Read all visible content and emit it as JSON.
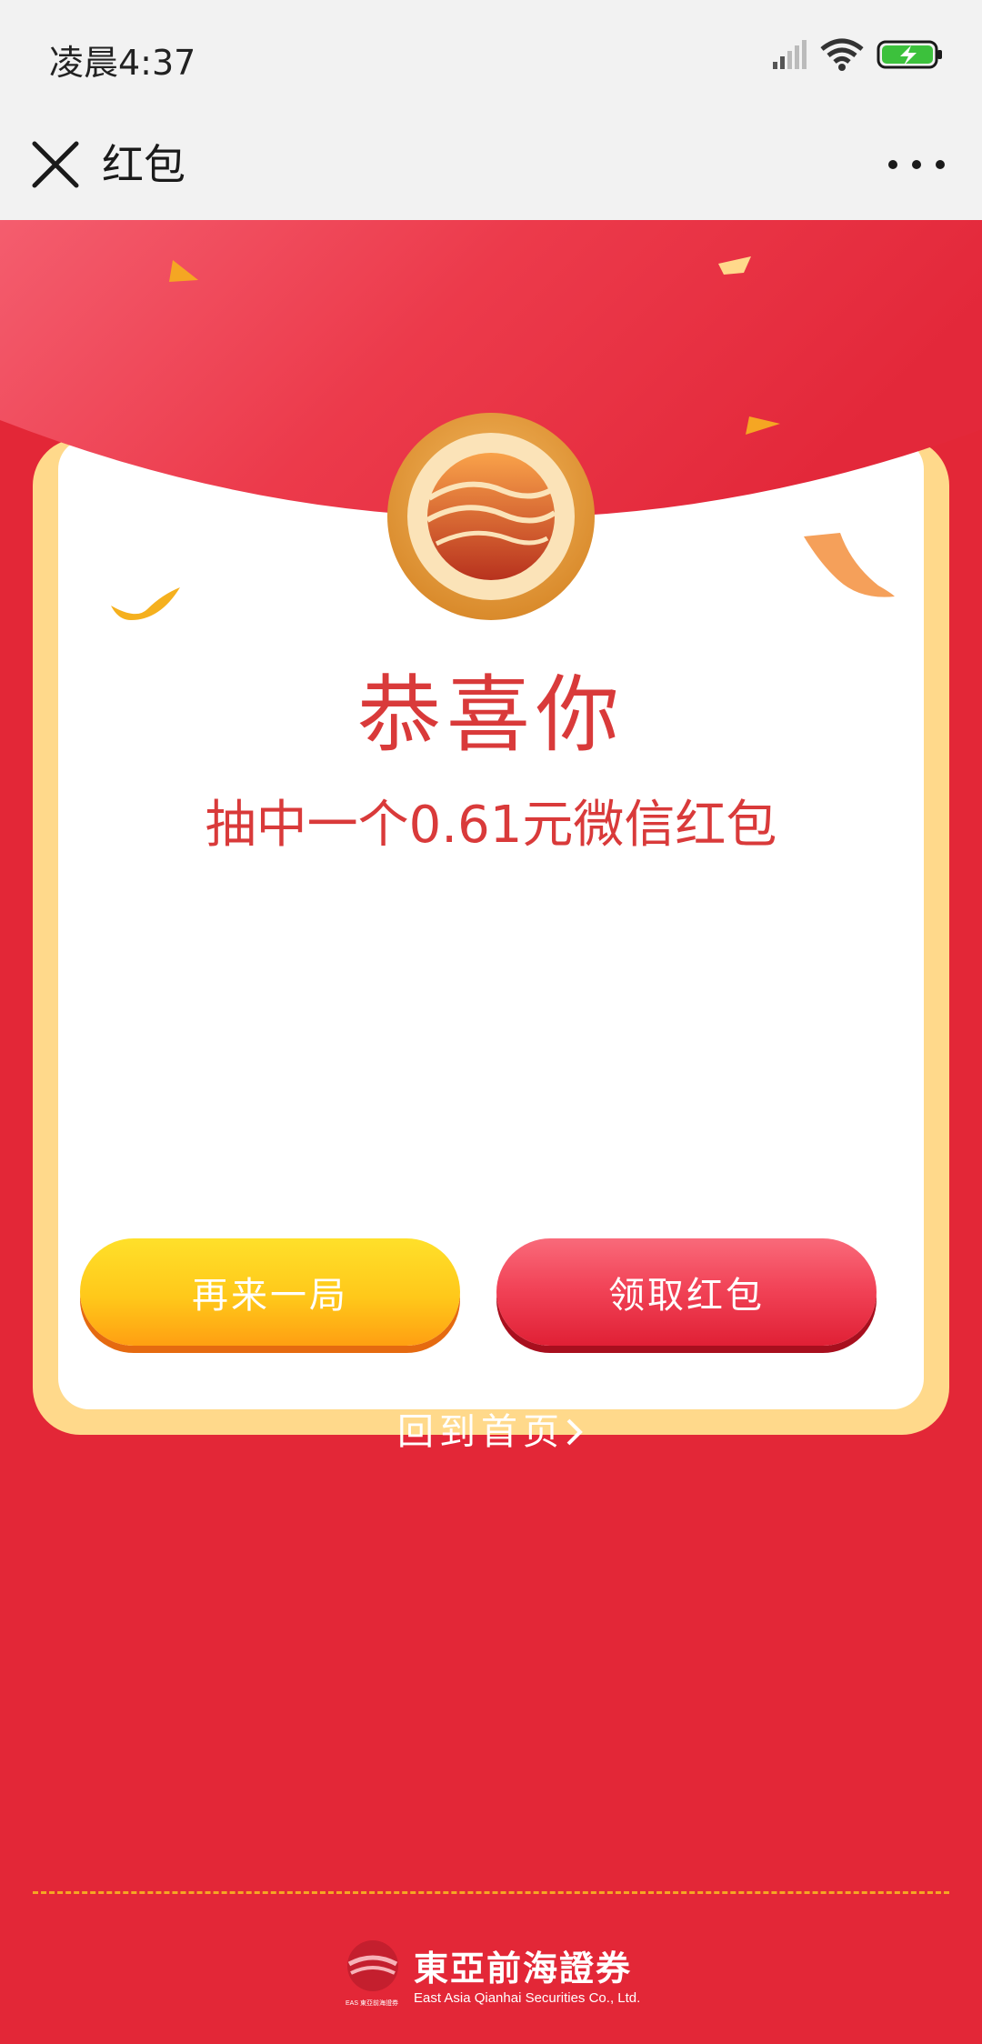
{
  "status": {
    "time": "凌晨4:37",
    "icons": [
      "signal-icon",
      "wifi-icon",
      "battery-charging-icon"
    ]
  },
  "nav": {
    "title": "红包",
    "close_icon": "close-icon",
    "more_icon": "more-icon"
  },
  "card": {
    "heading": "恭喜你",
    "prize_text": "抽中一个0.61元微信红包"
  },
  "buttons": {
    "again_label": "再来一局",
    "claim_label": "领取红包"
  },
  "links": {
    "back_home_label": "回到首页"
  },
  "footer": {
    "brand_cn": "東亞前海證券",
    "brand_en": "East Asia Qianhai Securities Co., Ltd.",
    "brand_small": "EAS 東亞前海證券"
  },
  "colors": {
    "background": "#e32737",
    "card_border": "#ffd98b",
    "text_red": "#d93a3a",
    "again_button": "#ffc81a",
    "claim_button": "#f24458"
  }
}
